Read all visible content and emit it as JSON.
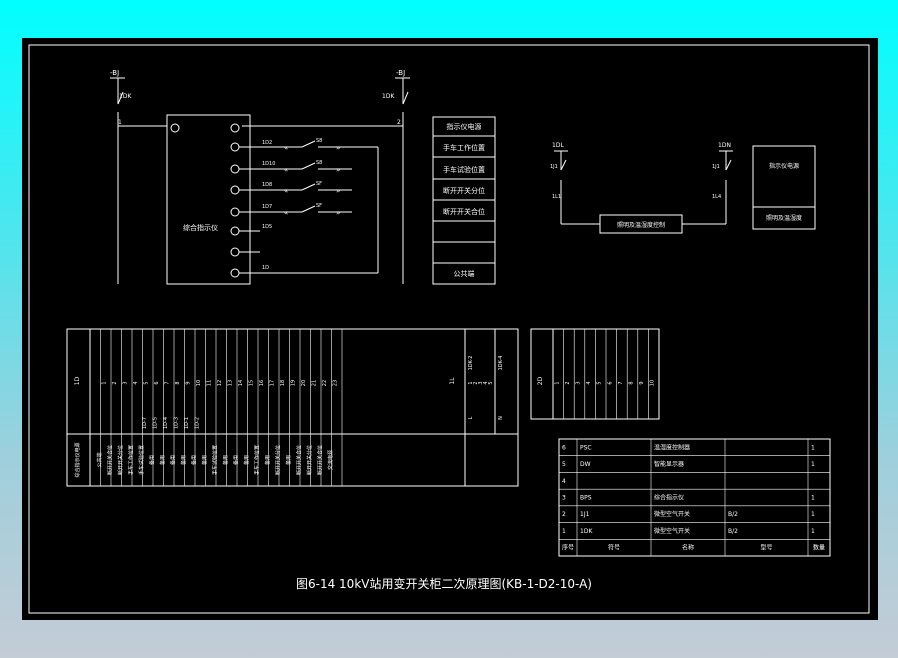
{
  "caption": "图6-14 10kV站用变开关柜二次原理图(KB-1-D2-10-A)",
  "circuit": {
    "bus_left": "-BJ",
    "bus_right": "-BJ",
    "breaker_left": "1DK",
    "breaker_right": "1DK",
    "node_left": "1",
    "node_right": "2",
    "relay_label": "综合指示仪",
    "relay_terminals": [
      "1D2",
      "1D10",
      "1D8",
      "1D7",
      "1D5",
      "1D"
    ],
    "contacts": [
      "S8",
      "S8",
      "SF",
      "SF"
    ],
    "function_labels": [
      "指示仪电源",
      "手车工作位置",
      "手车试验位置",
      "断开开关分位",
      "断开开关合位",
      "",
      "",
      "公共端"
    ]
  },
  "lighting": {
    "left_top": "1DL",
    "left_switch": "1J1",
    "left_bottom": "1L1",
    "right_top": "1DN",
    "right_switch": "1J1",
    "right_bottom": "1L4",
    "heater_label": "照明及温湿度控制",
    "box_labels": [
      "指示仪电源",
      "照明及温湿度"
    ]
  },
  "terminal_block_1": {
    "id": "1D",
    "numbers": [
      "1",
      "2",
      "3",
      "4",
      "5",
      "6",
      "7",
      "8",
      "9",
      "10",
      "11",
      "12",
      "13",
      "14",
      "15",
      "16",
      "17",
      "18",
      "19",
      "20",
      "21",
      "22",
      "23"
    ],
    "groups": [
      "1D-7",
      "1D-5",
      "1D-4",
      "1D-3",
      "1D-1",
      "1D-2"
    ],
    "descs": [
      "综合指示仪电源",
      "公共端",
      "断开开关合位",
      "断开开关分位",
      "手车工作位置",
      "手车试验位置",
      "备用",
      "备用",
      "备用",
      "备用",
      "备用",
      "备用",
      "手车试验位置",
      "备用",
      "备用",
      "备用",
      "手车工作位置",
      "备用",
      "断开开关分位",
      "备用",
      "断开开关合位",
      "断开开关分位",
      "断开开关合位",
      "交流电源"
    ],
    "side_labels": [
      "1DK-2",
      "1DK-4",
      "L",
      "N"
    ],
    "side_nums": [
      "1",
      "2",
      "3",
      "4",
      "5"
    ],
    "side_col": "1L"
  },
  "terminal_block_2": {
    "id": "2D",
    "numbers": [
      "1",
      "2",
      "3",
      "4",
      "5",
      "6",
      "7",
      "8",
      "9",
      "10"
    ]
  },
  "bom": {
    "header": [
      "序号",
      "符号",
      "名称",
      "型号",
      "数量"
    ],
    "rows": [
      [
        "6",
        "PSC",
        "温湿度控制器",
        "",
        "1"
      ],
      [
        "5",
        "DW",
        "智能显示器",
        "",
        "1"
      ],
      [
        "4",
        "",
        "",
        "",
        ""
      ],
      [
        "3",
        "BPS",
        "综合指示仪",
        "",
        "1"
      ],
      [
        "2",
        "1J1",
        "微型空气开关",
        "B/2",
        "1"
      ],
      [
        "1",
        "1DK",
        "微型空气开关",
        "B/2",
        "1"
      ]
    ]
  },
  "colors": {
    "background": "#000000",
    "line": "#ffffff",
    "frame_top": "#00ffff",
    "frame_bottom": "#c4ccd6"
  }
}
